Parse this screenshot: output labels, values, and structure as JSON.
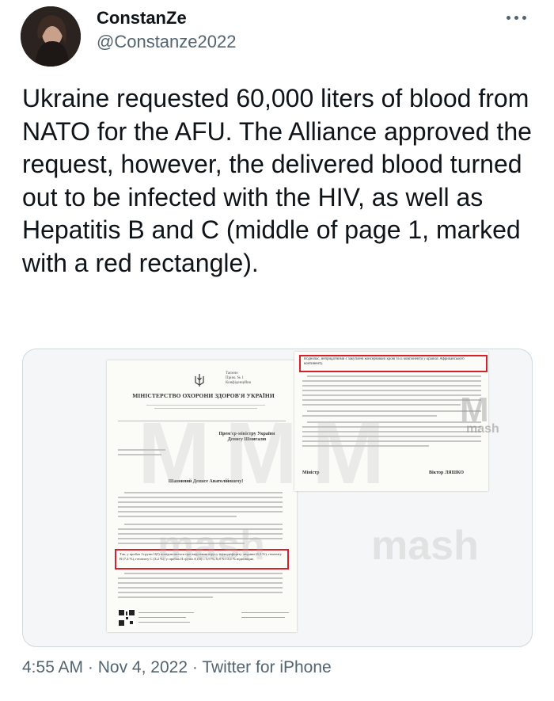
{
  "author": {
    "display_name": "ConstanZe",
    "handle": "@Constanze2022",
    "avatar_icon": "profile-photo"
  },
  "tweet": {
    "text": "Ukraine requested 60,000 liters of blood from NATO for the AFU.  The Alliance approved the request, however, the delivered blood turned out to be infected with the HIV, as well as Hepatitis B and C (middle of page 1, marked with a red rectangle)."
  },
  "media": {
    "page1": {
      "ministry": "МІНІСТЕРСТВО ОХОРОНИ ЗДОРОВ'Я УКРАЇНИ",
      "stamp": "Таємно\nПрим. № 1\nКонфіденційно",
      "recipient": "Прем'єр-міністру України\nДенису Шмигалю",
      "salutation": "Шановний Денисе Анатолійовичу!",
      "highlighted": "Так, у пробах І групи О(І) повідомляється про виділення вірусу імунодефіциту людини (6,3 %), гепатиту В (7,4 %), гепатиту С (3,2 %); у пробах ІІ групи А (ІІ) – 5,9 %, 6,8 % і 3,1 % відповідно."
    },
    "page2": {
      "highlighted": "Водночас, непридатними є закуплені консервовані крові та її компоненти у країнах Африканського континенту.",
      "signer_title": "Міністр",
      "signer_name": "Віктор ЛЯШКО"
    },
    "watermark": "mash",
    "highlight_color": "#d6202a"
  },
  "meta": {
    "time": "4:55 AM",
    "separator": "·",
    "date": "Nov 4, 2022",
    "source": "Twitter for iPhone"
  }
}
